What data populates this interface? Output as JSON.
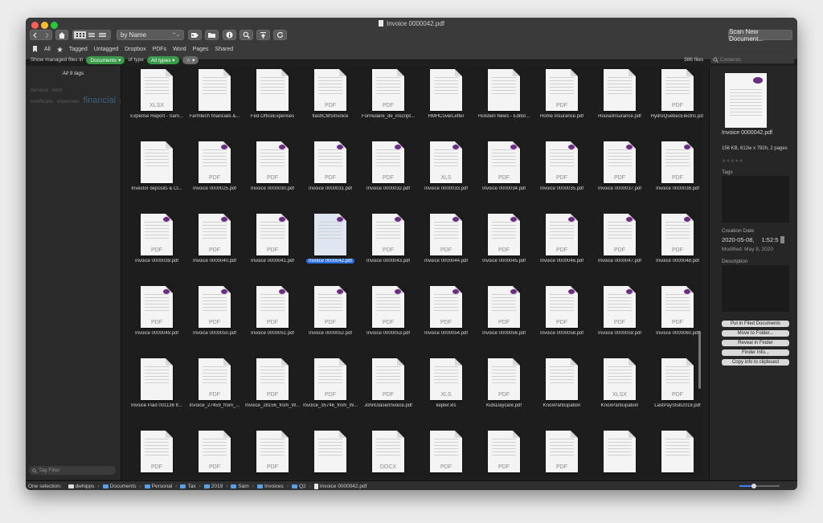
{
  "window": {
    "title": "Invoice 0000042.pdf"
  },
  "toolbar": {
    "sort_label": "by Name",
    "sort_arrows": "⌃⌄",
    "scan_label": "Scan New Document..."
  },
  "filters": [
    "All",
    "Tagged",
    "Untagged",
    "Dropbox",
    "PDFs",
    "Word",
    "Pages",
    "Shared"
  ],
  "managed": {
    "prefix": "Show managed files in",
    "location": "Documents",
    "middle": "of type",
    "type": "All types",
    "star_label": "☆ ▾",
    "file_count": "386 files",
    "search_placeholder": "Contents"
  },
  "sidebar": {
    "tags_header": "All 9 tags",
    "tags": [
      {
        "text": "berwick",
        "size": 6.5,
        "color": "#5a5a5a"
      },
      {
        "text": "birth certificate",
        "size": 6.5,
        "color": "#5a5a5a"
      },
      {
        "text": "expenses",
        "size": 6.5,
        "color": "#5a5a5a"
      },
      {
        "text": "financial",
        "size": 11,
        "color": "#3d5f7d"
      },
      {
        "text": "income",
        "size": 6.5,
        "color": "#5a5a5a"
      },
      {
        "text": "mortgage",
        "size": 6.5,
        "color": "#5a5a5a"
      },
      {
        "text": "personal",
        "size": 6.5,
        "color": "#5a5a5a"
      },
      {
        "text": "taxes",
        "size": 9,
        "color": "#4e6a80"
      },
      {
        "text": "test",
        "size": 6.5,
        "color": "#5a5a5a"
      }
    ],
    "tag_filter_placeholder": "Tag Filter"
  },
  "files": [
    {
      "name": "Expense Report - Sam...",
      "fmt": "XLSX"
    },
    {
      "name": "Farmtech financials &...",
      "fmt": ""
    },
    {
      "name": "Fed-OfficeExpenses",
      "fmt": ""
    },
    {
      "name": "flashCMSInvoice",
      "fmt": "PDF"
    },
    {
      "name": "Formulaire_de_inscript...",
      "fmt": "PDF"
    },
    {
      "name": "HMHCoverLetter",
      "fmt": ""
    },
    {
      "name": "Holstein News - Editor...",
      "fmt": ""
    },
    {
      "name": "Home Insurance.pdf",
      "fmt": "PDF"
    },
    {
      "name": "HouseInsurance.pdf",
      "fmt": ""
    },
    {
      "name": "HydroQuebecElectric.pdf",
      "fmt": "PDF"
    },
    {
      "name": "Investor deposits & Cl...",
      "fmt": ""
    },
    {
      "name": "Invoice 0000025.pdf",
      "fmt": "PDF"
    },
    {
      "name": "Invoice 0000030.pdf",
      "fmt": "PDF"
    },
    {
      "name": "Invoice 0000031.pdf",
      "fmt": "PDF"
    },
    {
      "name": "Invoice 0000032.pdf",
      "fmt": "PDF"
    },
    {
      "name": "Invoice 0000033.pdf",
      "fmt": "XLS"
    },
    {
      "name": "Invoice 0000034.pdf",
      "fmt": "PDF"
    },
    {
      "name": "Invoice 0000035.pdf",
      "fmt": "PDF"
    },
    {
      "name": "Invoice 0000037.pdf",
      "fmt": "PDF"
    },
    {
      "name": "Invoice 0000038.pdf",
      "fmt": "PDF"
    },
    {
      "name": "Invoice 0000039.pdf",
      "fmt": "PDF"
    },
    {
      "name": "Invoice 0000040.pdf",
      "fmt": "PDF"
    },
    {
      "name": "Invoice 0000041.pdf",
      "fmt": "PDF"
    },
    {
      "name": "Invoice 0000042.pdf",
      "fmt": "",
      "selected": true
    },
    {
      "name": "Invoice 0000043.pdf",
      "fmt": "PDF"
    },
    {
      "name": "Invoice 0000044.pdf",
      "fmt": "PDF"
    },
    {
      "name": "Invoice 0000045.pdf",
      "fmt": "PDF"
    },
    {
      "name": "Invoice 0000046.pdf",
      "fmt": "PDF"
    },
    {
      "name": "Invoice 0000047.pdf",
      "fmt": "PDF"
    },
    {
      "name": "Invoice 0000048.pdf",
      "fmt": "PDF"
    },
    {
      "name": "Invoice 0000049.pdf",
      "fmt": "PDF"
    },
    {
      "name": "Invoice 0000050.pdf",
      "fmt": "PDF"
    },
    {
      "name": "Invoice 0000051.pdf",
      "fmt": "PDF"
    },
    {
      "name": "Invoice 0000052.pdf",
      "fmt": "PDF"
    },
    {
      "name": "Invoice 0000053.pdf",
      "fmt": "PDF"
    },
    {
      "name": "Invoice 0000054.pdf",
      "fmt": "PDF"
    },
    {
      "name": "Invoice 0000056.pdf",
      "fmt": "PDF"
    },
    {
      "name": "Invoice 0000058.pdf",
      "fmt": "PDF"
    },
    {
      "name": "Invoice 0000059.pdf",
      "fmt": "PDF"
    },
    {
      "name": "Invoice 0000060.pdf",
      "fmt": "PDF"
    },
    {
      "name": "Invoice Paid 001136 fr...",
      "fmt": ""
    },
    {
      "name": "Invoice_27459_from_...",
      "fmt": "PDF"
    },
    {
      "name": "Invoice_28156_from_W...",
      "fmt": "PDF"
    },
    {
      "name": "Invoice_35746_from_W...",
      "fmt": "PDF"
    },
    {
      "name": "JohnGlaserInvoice.pdf",
      "fmt": "PDF"
    },
    {
      "name": "kepler.xls",
      "fmt": "XLS"
    },
    {
      "name": "KidsDaycare.pdf",
      "fmt": "PDF"
    },
    {
      "name": "KnoxParticipation",
      "fmt": ""
    },
    {
      "name": "KnoxParticipation",
      "fmt": "XLSX"
    },
    {
      "name": "LastPayStub2018.pdf",
      "fmt": "PDF"
    },
    {
      "name": "",
      "fmt": "PDF"
    },
    {
      "name": "",
      "fmt": "PDF"
    },
    {
      "name": "",
      "fmt": "PDF"
    },
    {
      "name": "",
      "fmt": ""
    },
    {
      "name": "",
      "fmt": "DOCX"
    },
    {
      "name": "",
      "fmt": "PDF"
    },
    {
      "name": "",
      "fmt": "PDF"
    },
    {
      "name": "",
      "fmt": "PDF"
    },
    {
      "name": "",
      "fmt": ""
    },
    {
      "name": "",
      "fmt": ""
    }
  ],
  "inspector": {
    "filename": "Invoice 0000042.pdf",
    "info": "156 KB, 612w x 792h, 2 pages",
    "rating_stars": "★★★★★",
    "tags_label": "Tags",
    "creation_label": "Creation Date",
    "creation_value": "2020-05-08,",
    "creation_time": "1:52:5",
    "modified": "Modified: May 8, 2020",
    "description_label": "Description",
    "buttons": [
      "Put in Filed Documents",
      "Move to Folder...",
      "Reveal in Finder",
      "Finder Info...",
      "Copy info to clipboard"
    ]
  },
  "status": {
    "selection": "One selection:",
    "breadcrumb": [
      "dwhipps",
      "Documents",
      "Personal",
      "Tax",
      "2019",
      "Sam",
      "Invoices",
      "Q2",
      "Invoice 0000042.pdf"
    ],
    "zoom_level": 0.35
  },
  "colors": {
    "accent": "#2b6fe0",
    "green_pill": "#3a9a4a",
    "doc_purple": "#6b2c83"
  }
}
